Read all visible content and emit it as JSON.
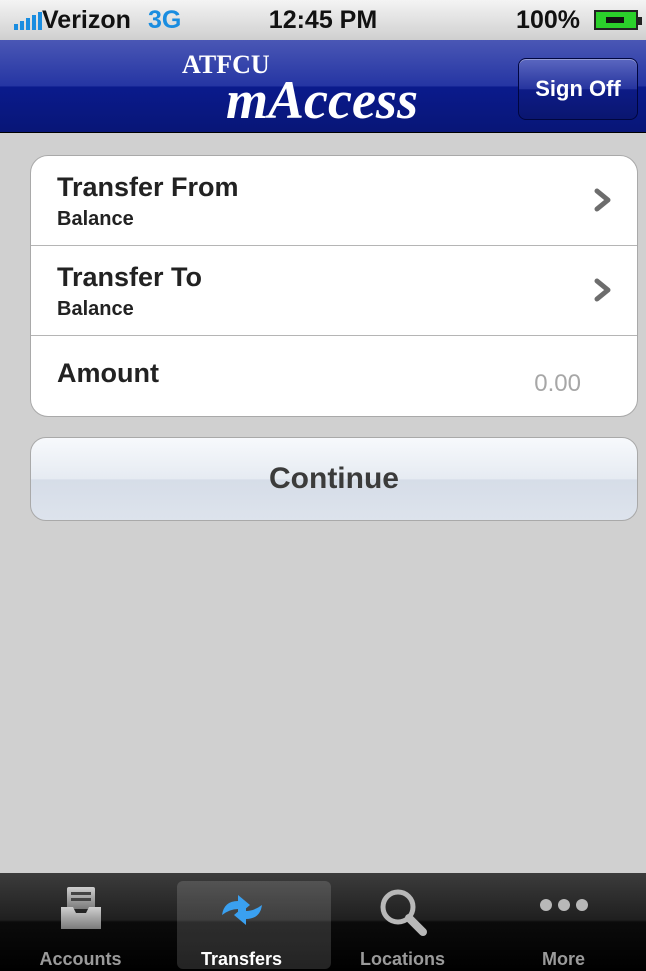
{
  "status_bar": {
    "carrier": "Verizon",
    "network": "3G",
    "time": "12:45 PM",
    "battery": "100%"
  },
  "header": {
    "brand_top": "ATFCU",
    "brand_main": "mAccess",
    "sign_off": "Sign Off"
  },
  "form": {
    "transfer_from": {
      "title": "Transfer From",
      "subtitle": "Balance"
    },
    "transfer_to": {
      "title": "Transfer To",
      "subtitle": "Balance"
    },
    "amount": {
      "label": "Amount",
      "placeholder": "0.00"
    }
  },
  "continue_label": "Continue",
  "tabs": [
    {
      "label": "Accounts",
      "icon": "inbox-tray-icon",
      "active": false
    },
    {
      "label": "Transfers",
      "icon": "transfer-arrows-icon",
      "active": true
    },
    {
      "label": "Locations",
      "icon": "search-icon",
      "active": false
    },
    {
      "label": "More",
      "icon": "more-dots-icon",
      "active": false
    }
  ],
  "colors": {
    "header_blue": "#0a1a8c",
    "accent_blue": "#1a8de0",
    "background": "#d0d0d0"
  }
}
